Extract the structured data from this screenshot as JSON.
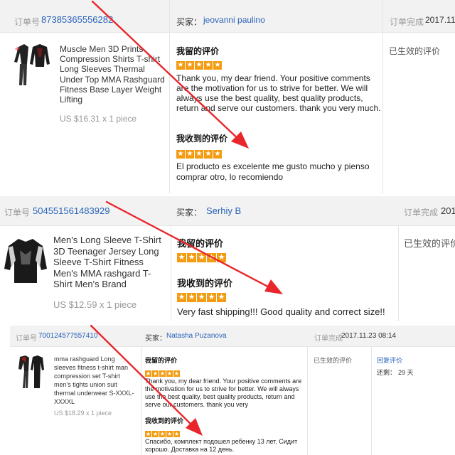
{
  "orders": [
    {
      "order_label": "订单号",
      "order_no": "87385365556282",
      "buyer_label": "买家：",
      "buyer": "jeovanni paulino",
      "done_label": "订单完成",
      "done_time": "2017.11",
      "product_title": "Muscle Men 3D Prints Compression Shirts T-shirt Long Sleeves Thermal Under Top MMA Rashguard Fitness Base Layer Weight Lifting",
      "price": "US $16.31 x 1 piece",
      "left_review_label": "我留的评价",
      "left_review_stars": 5,
      "left_review_text": "Thank you, my dear friend. Your positive comments are the motivation for us to strive for better. We will always use the best quality, best quality products, return and serve our customers. thank you very much.",
      "received_review_label": "我收到的评价",
      "received_review_stars": 5,
      "received_review_text": "El producto es excelente me gusto mucho y pienso comprar otro, lo recomiendo",
      "status": "已生效的评价"
    },
    {
      "order_label": "订单号",
      "order_no": "504551561483929",
      "buyer_label": "买家：",
      "buyer": "Serhiy B",
      "done_label": "订单完成",
      "done_time": "201",
      "product_title": "Men's Long Sleeve T-Shirt 3D Teenager Jersey Long Sleeve T-Shirt Fitness Men's MMA rashgard T-Shirt Men's Brand",
      "price": "US $12.59 x 1 piece",
      "left_review_label": "我留的评价",
      "left_review_stars": 5,
      "received_review_label": "我收到的评价",
      "received_review_stars": 5,
      "received_review_text": "Very fast shipping!!! Good quality and correct size!!",
      "status": "已生效的评价"
    },
    {
      "order_label": "订单号",
      "order_no": "700124577557410",
      "buyer_label": "买家：",
      "buyer": "Natasha Puzanova",
      "done_label": "订单完成",
      "done_time": "2017.11.23 08:14",
      "product_title": "mma rashguard Long sleeves fitness t-shirt man compression set T-shirt men's tights union suit thermal underwear S-XXXL-XXXXL",
      "price": "US $18.29 x 1 piece",
      "left_review_label": "我留的评价",
      "left_review_stars": 5,
      "left_review_text": "Thank you, my dear friend. Your positive comments are the motivation for us to strive for better. We will always use the best quality, best quality products, return and serve our customers. thank you very",
      "received_review_label": "我收到的评价",
      "received_review_stars": 5,
      "received_review_text": "Спасибо, комплект подошел ребенку 13 лет. Сидит хорошо. Доставка на 12 день.",
      "status": "已生效的评价",
      "reply_link": "回复评价",
      "remaining_label": "还剩：",
      "remaining_value": "29 天"
    }
  ],
  "icons": {
    "star": "star-icon",
    "arrow": "red-arrow-annotation"
  },
  "colors": {
    "star": "#f39c12",
    "link": "#2a63b9",
    "arrow": "#e8262b",
    "header_bg": "#f2f2f2"
  }
}
